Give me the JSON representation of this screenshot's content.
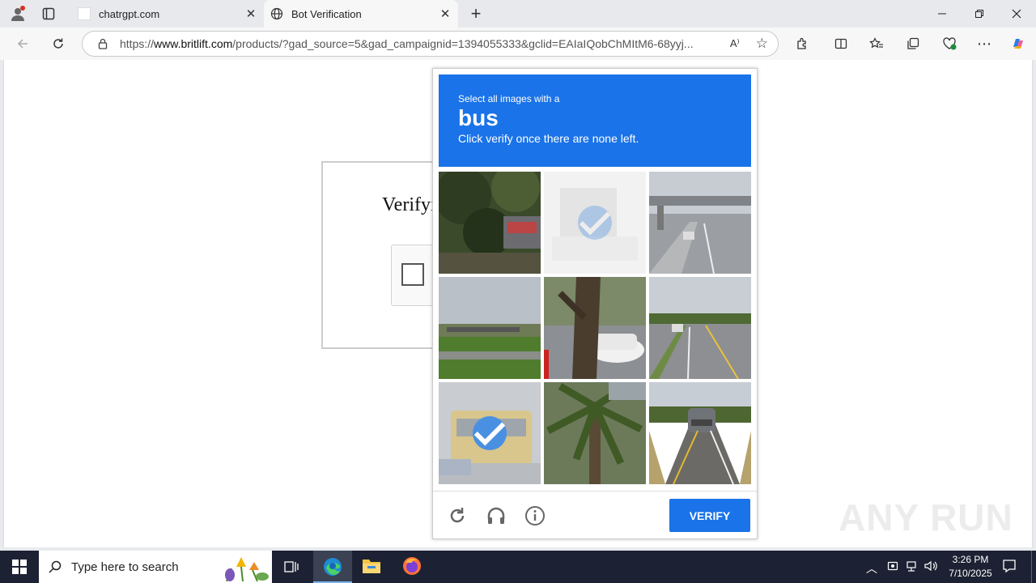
{
  "browser": {
    "tabs": [
      {
        "title": "chatrgpt.com"
      },
      {
        "title": "Bot Verification"
      }
    ],
    "url_prefix": "https://",
    "url_domain": "www.britlift.com",
    "url_rest": "/products/?gad_source=5&gad_campaignid=1394055333&gclid=EAIaIQobChMItM6-68yyj..."
  },
  "page": {
    "heading": "Verifyi"
  },
  "captcha": {
    "instruction": "Select all images with a",
    "target": "bus",
    "sub": "Click verify once there are none left.",
    "verify_label": "VERIFY",
    "tiles": [
      {
        "scene": "trees",
        "selected": false
      },
      {
        "scene": "bus-faded",
        "selected": true
      },
      {
        "scene": "road-overpass",
        "selected": false
      },
      {
        "scene": "bridge-grass",
        "selected": false
      },
      {
        "scene": "tree-car",
        "selected": false
      },
      {
        "scene": "road-cars",
        "selected": false
      },
      {
        "scene": "school-bus",
        "selected": true
      },
      {
        "scene": "palm",
        "selected": false
      },
      {
        "scene": "road-car-rear",
        "selected": false
      }
    ]
  },
  "watermark": "ANY RUN",
  "taskbar": {
    "search_placeholder": "Type here to search",
    "time": "3:26 PM",
    "date": "7/10/2025"
  },
  "colors": {
    "accent": "#1a73e8",
    "taskbar": "#1c2233"
  }
}
